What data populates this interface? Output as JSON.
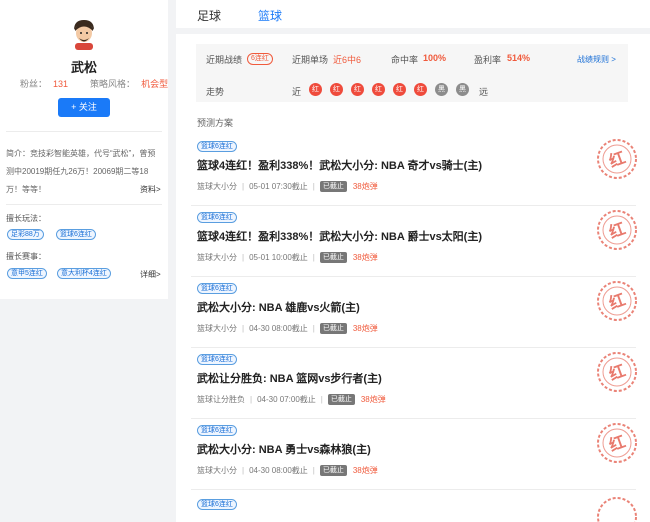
{
  "profile": {
    "name": "武松",
    "fans_label": "粉丝：",
    "fans_value": "131",
    "style_label": "策略风格：",
    "style_value": "机会型",
    "follow_label": "+ 关注",
    "intro": "简介：竞技彩智能英雄，代号“武松”，曾预测中20019期任九26万！20069期二等18万！等等！",
    "intro_more": "资料>",
    "skills_label": "擅长玩法：",
    "skills": [
      "足彩88万",
      "篮球6连红"
    ],
    "events_label": "擅长赛事：",
    "events": [
      "意甲5连红",
      "意大利杯4连红"
    ],
    "events_more": "详细>"
  },
  "nav": {
    "tabs": [
      "足球",
      "篮球"
    ],
    "active": "篮球"
  },
  "stats": {
    "recent_label": "近期战绩",
    "recent_tag": "6连红",
    "single_label": "近期单场",
    "single_value": "近6中6",
    "hit_label": "命中率",
    "hit_value": "100%",
    "profit_label": "盈利率",
    "profit_value": "514%",
    "rules_link": "战绩规则 >",
    "trend_label": "走势",
    "trend_near": "近",
    "trend_far": "远",
    "trend": [
      {
        "text": "红",
        "color": "#ef4b3c"
      },
      {
        "text": "红",
        "color": "#ef4b3c"
      },
      {
        "text": "红",
        "color": "#ef4b3c"
      },
      {
        "text": "红",
        "color": "#ef4b3c"
      },
      {
        "text": "红",
        "color": "#ef4b3c"
      },
      {
        "text": "红",
        "color": "#ef4b3c"
      },
      {
        "text": "黑",
        "color": "#8c8c8c"
      },
      {
        "text": "黑",
        "color": "#8c8c8c"
      }
    ]
  },
  "section_title": "预测方案",
  "items": [
    {
      "tag": "篮球6连红",
      "title": "篮球4连红！盈利338%！武松大小分: NBA 奇才vs骑士(主)",
      "type": "篮球大小分",
      "time": "05-01 07:30截止",
      "status": "已截止",
      "price": "38炮弹"
    },
    {
      "tag": "篮球6连红",
      "title": "篮球4连红！盈利338%！武松大小分: NBA 爵士vs太阳(主)",
      "type": "篮球大小分",
      "time": "05-01 10:00截止",
      "status": "已截止",
      "price": "38炮弹"
    },
    {
      "tag": "篮球6连红",
      "title": "武松大小分: NBA 雄鹿vs火箭(主)",
      "type": "篮球大小分",
      "time": "04-30 08:00截止",
      "status": "已截止",
      "price": "38炮弹"
    },
    {
      "tag": "篮球6连红",
      "title": "武松让分胜负: NBA 篮网vs步行者(主)",
      "type": "篮球让分胜负",
      "time": "04-30 07:00截止",
      "status": "已截止",
      "price": "38炮弹"
    },
    {
      "tag": "篮球6连红",
      "title": "武松大小分: NBA 勇士vs森林狼(主)",
      "type": "篮球大小分",
      "time": "04-30 08:00截止",
      "status": "已截止",
      "price": "38炮弹"
    }
  ],
  "last_item_tag": "篮球6连红",
  "stamp_text": "红",
  "colors": {
    "accent": "#1a7af8",
    "red": "#f05a3c",
    "stamp": "#e35a4a"
  }
}
